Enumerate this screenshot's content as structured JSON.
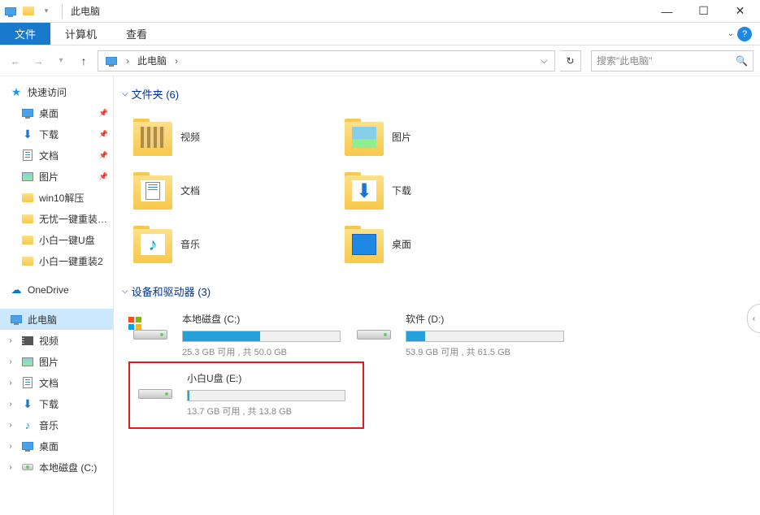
{
  "title": "此电脑",
  "ribbon": {
    "file_tab": "文件",
    "computer_tab": "计算机",
    "view_tab": "查看"
  },
  "addressbar": {
    "location": "此电脑",
    "search_placeholder": "搜索\"此电脑\""
  },
  "window_controls": {
    "minimize": "—",
    "maximize": "☐",
    "close": "✕"
  },
  "sidebar": {
    "quick_access": "快速访问",
    "desktop": "桌面",
    "downloads": "下载",
    "documents": "文档",
    "pictures": "图片",
    "win10unzip": "win10解压",
    "wuyou": "无忧一键重装系统",
    "xiaobai_udisk": "小白一键U盘",
    "xiaobai_reinstall2": "小白一键重装2",
    "onedrive": "OneDrive",
    "this_pc": "此电脑",
    "videos": "视频",
    "pictures2": "图片",
    "documents2": "文档",
    "downloads2": "下载",
    "music": "音乐",
    "desktop2": "桌面",
    "local_disk_c": "本地磁盘 (C:)"
  },
  "sections": {
    "folders": {
      "title": "文件夹 (6)"
    },
    "devices": {
      "title": "设备和驱动器 (3)"
    }
  },
  "folders": {
    "videos": "视频",
    "pictures": "图片",
    "documents": "文档",
    "downloads": "下载",
    "music": "音乐",
    "desktop": "桌面"
  },
  "drives": {
    "c": {
      "name": "本地磁盘 (C:)",
      "info": "25.3 GB 可用 , 共 50.0 GB",
      "fill_percent": 49
    },
    "d": {
      "name": "软件 (D:)",
      "info": "53.9 GB 可用 , 共 61.5 GB",
      "fill_percent": 12
    },
    "e": {
      "name": "小白U盘 (E:)",
      "info": "13.7 GB 可用 , 共 13.8 GB",
      "fill_percent": 1
    }
  }
}
